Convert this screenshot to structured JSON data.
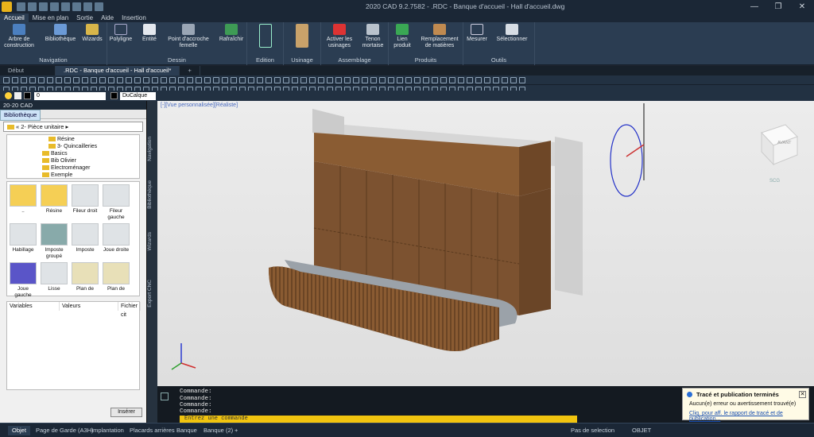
{
  "titlebar": {
    "title": "2020 CAD 9.2.7582 - .RDC - Banque d'accueil - Hall d'accueil.dwg",
    "window_buttons": [
      "—",
      "❐",
      "✕"
    ]
  },
  "menu": [
    "Accueil",
    "Mise en plan",
    "Sortie",
    "Aide",
    "Insertion"
  ],
  "ribbon": {
    "navigation": {
      "label": "Navigation",
      "buttons": [
        "Arbre de construction",
        "Bibliothèque",
        "Wizards"
      ]
    },
    "dessin": {
      "label": "Dessin",
      "buttons": [
        "Polyligne",
        "Entité",
        "Point d'accroche femelle",
        "Rafraîchir"
      ]
    },
    "edition": {
      "label": "Edition"
    },
    "usinage": {
      "label": "Usinage"
    },
    "assemblage": {
      "label": "Assemblage",
      "buttons": [
        "Activer les usinages",
        "Tenon mortaise"
      ]
    },
    "produits": {
      "label": "Produits",
      "buttons": [
        "Lien produit",
        "Remplacement de matières"
      ]
    },
    "outils": {
      "label": "Outils",
      "buttons": [
        "Mesurer",
        "Sélectionner"
      ]
    }
  },
  "doctabs": [
    "Début",
    ".RDC - Banque d'accueil - Hall d'accueil*",
    "+"
  ],
  "layer": {
    "name": "0",
    "linetype": "DuCalque"
  },
  "leftpanel": {
    "title": "20-20 CAD",
    "tab": "Bibliothèque",
    "path": "2- Pièce unitaire",
    "tree": [
      "Résine",
      "3- Quincailleries",
      "Basics",
      "Bib Olivier",
      "Electroménager",
      "Exemple"
    ],
    "grid": [
      "..",
      "Résine",
      "Fileur droit",
      "Fileur gauche",
      "Habillage",
      "Imposte groupé",
      "Imposte",
      "Joue droite",
      "Joue gauche",
      "Lisse",
      "Plan de",
      "Plan de"
    ],
    "table_headers": [
      "Variables",
      "Valeurs",
      "Fichier cit"
    ],
    "insert_label": "Insérer"
  },
  "sidetabs": [
    "Navigation",
    "Bibliothèque",
    "Wizards",
    "Export CNC"
  ],
  "viewport": {
    "label": "[-][Vue personnalisée][Réaliste]",
    "viewcube_face": "AVANT",
    "ucs": "SCG"
  },
  "command": {
    "history": [
      "Commande:",
      "Commande:",
      "Commande:",
      "Commande:"
    ],
    "prompt": "Entrez une commande"
  },
  "status": {
    "tabs": [
      "Objet",
      "Page de Garde (A3H)",
      "Implantation",
      "Placards arrières",
      "Banque",
      "Banque (2)",
      "+"
    ],
    "mode": "Pas de selection",
    "objet": "OBJET"
  },
  "notification": {
    "title": "Tracé et publication terminés",
    "body": "Aucun(e) erreur ou avertissement trouvé(e)",
    "link": "Cliq. pour aff. le rapport de tracé et de publication..."
  },
  "colors": {
    "wood": "#7a5230",
    "counter": "#9ba2a9",
    "accent": "#f1c40f"
  }
}
